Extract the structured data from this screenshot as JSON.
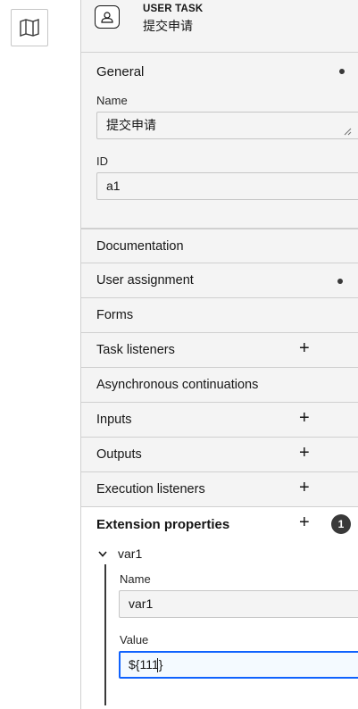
{
  "canvas": {
    "map_icon": "map-icon"
  },
  "header": {
    "type_label": "USER TASK",
    "element_name": "提交申请",
    "icon": "user-task-icon"
  },
  "general": {
    "title": "General",
    "name_label": "Name",
    "name_value": "提交申请",
    "id_label": "ID",
    "id_value": "a1"
  },
  "groups": {
    "documentation": "Documentation",
    "user_assignment": "User assignment",
    "forms": "Forms",
    "task_listeners": "Task listeners",
    "async": "Asynchronous continuations",
    "inputs": "Inputs",
    "outputs": "Outputs",
    "execution_listeners": "Execution listeners"
  },
  "extension": {
    "title": "Extension properties",
    "count": "1",
    "item": {
      "title": "var1",
      "name_label": "Name",
      "name_value": "var1",
      "value_label": "Value",
      "value_value": "${111}"
    }
  },
  "plus_symbol": "+",
  "colors": {
    "accent": "#0f62fe",
    "panel_bg": "#f4f4f4",
    "text": "#161616"
  }
}
